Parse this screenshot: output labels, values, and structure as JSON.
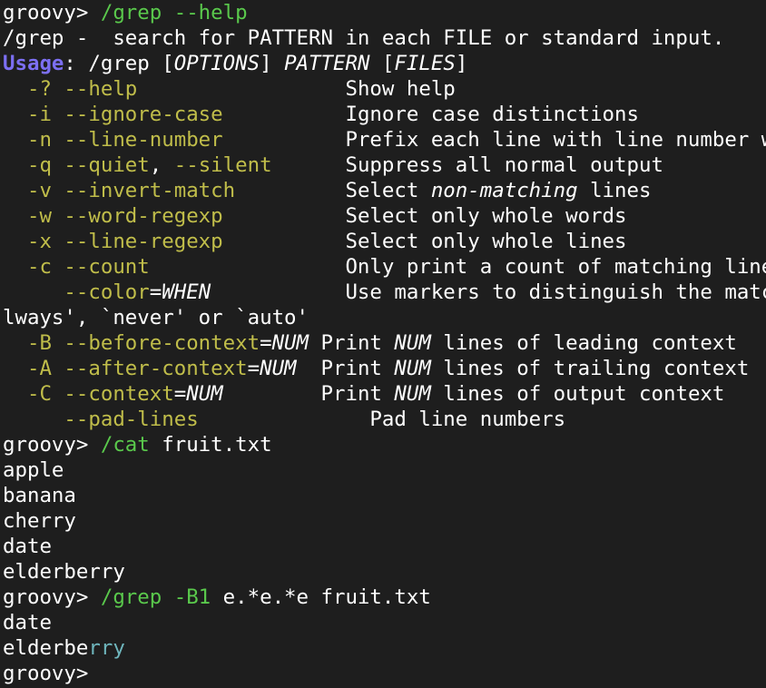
{
  "terminal": {
    "prompt": "groovy>",
    "lines": [
      [
        {
          "t": "groovy> ",
          "c": ""
        },
        {
          "t": "/grep --help",
          "c": "green"
        }
      ],
      [
        {
          "t": "/grep -  search for PATTERN in each FILE or standard input.",
          "c": ""
        }
      ],
      [
        {
          "t": "Usage",
          "c": "purple"
        },
        {
          "t": ": /grep [",
          "c": ""
        },
        {
          "t": "OPTIONS",
          "c": "it"
        },
        {
          "t": "] ",
          "c": ""
        },
        {
          "t": "PATTERN",
          "c": "it"
        },
        {
          "t": " [",
          "c": ""
        },
        {
          "t": "FILES",
          "c": "it"
        },
        {
          "t": "]",
          "c": ""
        }
      ],
      [
        {
          "t": "  -? --help",
          "c": "olive"
        },
        {
          "t": "                 Show help",
          "c": ""
        }
      ],
      [
        {
          "t": "  -i --ignore-case",
          "c": "olive"
        },
        {
          "t": "          Ignore case distinctions",
          "c": ""
        }
      ],
      [
        {
          "t": "  -n --line-number",
          "c": "olive"
        },
        {
          "t": "          Prefix each line with line number w",
          "c": ""
        }
      ],
      [
        {
          "t": "  -q --quiet",
          "c": "olive"
        },
        {
          "t": ", ",
          "c": ""
        },
        {
          "t": "--silent",
          "c": "olive"
        },
        {
          "t": "      Suppress all normal output",
          "c": ""
        }
      ],
      [
        {
          "t": "  -v --invert-match",
          "c": "olive"
        },
        {
          "t": "         Select ",
          "c": ""
        },
        {
          "t": "non-matching",
          "c": "it"
        },
        {
          "t": " lines",
          "c": ""
        }
      ],
      [
        {
          "t": "  -w --word-regexp",
          "c": "olive"
        },
        {
          "t": "          Select only whole words",
          "c": ""
        }
      ],
      [
        {
          "t": "  -x --line-regexp",
          "c": "olive"
        },
        {
          "t": "          Select only whole lines",
          "c": ""
        }
      ],
      [
        {
          "t": "  -c --count",
          "c": "olive"
        },
        {
          "t": "                Only print a count of matching line",
          "c": ""
        }
      ],
      [
        {
          "t": "     --color",
          "c": "olive"
        },
        {
          "t": "=",
          "c": ""
        },
        {
          "t": "WHEN",
          "c": "it"
        },
        {
          "t": "           Use markers to distinguish the matc",
          "c": ""
        }
      ],
      [
        {
          "t": "lways', `never' or `auto'",
          "c": ""
        }
      ],
      [
        {
          "t": "  -B --before-context",
          "c": "olive"
        },
        {
          "t": "=",
          "c": ""
        },
        {
          "t": "NUM",
          "c": "it"
        },
        {
          "t": " Print ",
          "c": ""
        },
        {
          "t": "NUM",
          "c": "it"
        },
        {
          "t": " lines of leading context",
          "c": ""
        }
      ],
      [
        {
          "t": "  -A --after-context",
          "c": "olive"
        },
        {
          "t": "=",
          "c": ""
        },
        {
          "t": "NUM",
          "c": "it"
        },
        {
          "t": "  Print ",
          "c": ""
        },
        {
          "t": "NUM",
          "c": "it"
        },
        {
          "t": " lines of trailing context",
          "c": ""
        }
      ],
      [
        {
          "t": "  -C --context",
          "c": "olive"
        },
        {
          "t": "=",
          "c": ""
        },
        {
          "t": "NUM",
          "c": "it"
        },
        {
          "t": "        Print ",
          "c": ""
        },
        {
          "t": "NUM",
          "c": "it"
        },
        {
          "t": " lines of output context",
          "c": ""
        }
      ],
      [
        {
          "t": "     --pad-lines",
          "c": "olive"
        },
        {
          "t": "              Pad line numbers",
          "c": ""
        }
      ],
      [
        {
          "t": "groovy> ",
          "c": ""
        },
        {
          "t": "/cat",
          "c": "green"
        },
        {
          "t": " fruit.txt",
          "c": ""
        }
      ],
      [
        {
          "t": "apple",
          "c": ""
        }
      ],
      [
        {
          "t": "banana",
          "c": ""
        }
      ],
      [
        {
          "t": "cherry",
          "c": ""
        }
      ],
      [
        {
          "t": "date",
          "c": ""
        }
      ],
      [
        {
          "t": "elderberry",
          "c": ""
        }
      ],
      [
        {
          "t": "groovy> ",
          "c": ""
        },
        {
          "t": "/grep -B1",
          "c": "green"
        },
        {
          "t": " e.*e.*e fruit.txt",
          "c": ""
        }
      ],
      [
        {
          "t": "date",
          "c": ""
        }
      ],
      [
        {
          "t": "elderbe",
          "c": ""
        },
        {
          "t": "rry",
          "c": "cyan"
        }
      ],
      [
        {
          "t": "groovy>",
          "c": ""
        }
      ]
    ]
  }
}
